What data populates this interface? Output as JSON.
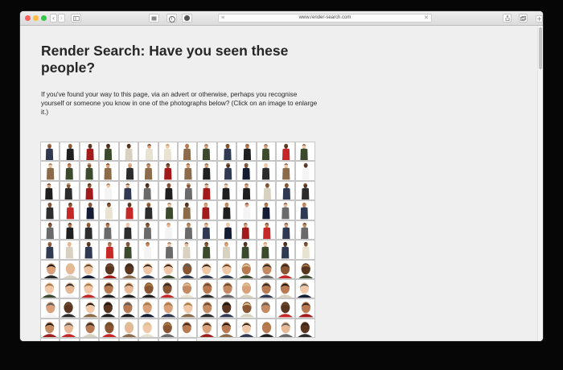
{
  "browser": {
    "url": "www.render-search.com",
    "toolbar_icons": [
      "back-icon",
      "forward-icon",
      "sidebar-icon",
      "privacy-icon",
      "info-icon",
      "extension-icon",
      "page-icon",
      "clear-icon",
      "share-icon",
      "tabs-icon",
      "new-tab-icon"
    ],
    "traffic_light_colors": [
      "#fc605c",
      "#fdbc40",
      "#34c84a"
    ]
  },
  "page": {
    "title": "Render Search: Have you seen these people?",
    "intro": "If you've found your way to this page, via an advert or otherwise, perhaps you recognise yourself or someone you know in one of the photographs below? (Click on an image to enlarge it.)"
  },
  "gallery": {
    "columns": 14,
    "rows": 11,
    "count": 148
  }
}
